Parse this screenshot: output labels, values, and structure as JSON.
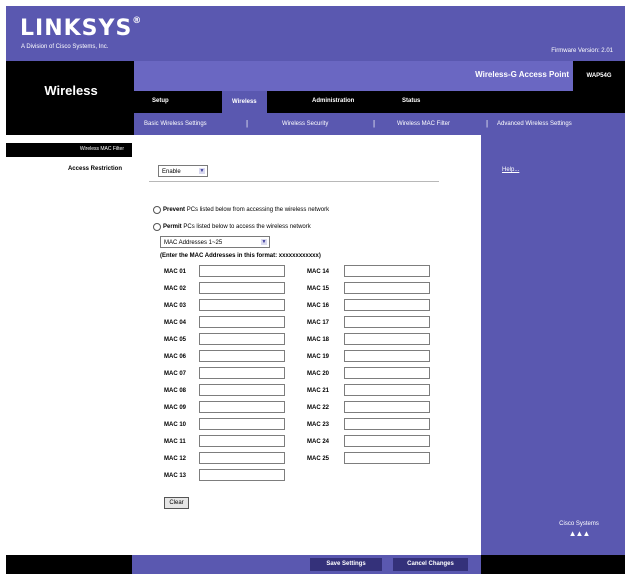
{
  "header": {
    "logo": "LINKSYS",
    "logo_mark": "®",
    "logo_sub": "A Division of Cisco Systems, Inc.",
    "firmware": "Firmware Version: 2.01"
  },
  "section": {
    "title": "Wireless"
  },
  "product": {
    "name": "Wireless-G Access Point",
    "model": "WAP54G"
  },
  "tabs": [
    {
      "label": "Setup"
    },
    {
      "label": "Wireless",
      "active": true
    },
    {
      "label": "Administration"
    },
    {
      "label": "Status"
    }
  ],
  "subtabs": [
    {
      "label": "Basic Wireless Settings"
    },
    {
      "label": "Wireless Security"
    },
    {
      "label": "Wireless MAC Filter",
      "active": true
    },
    {
      "label": "Advanced Wireless Settings"
    }
  ],
  "left": {
    "label1": "Wireless MAC Filter",
    "label2": "Access Restriction"
  },
  "restriction": {
    "value": "Enable",
    "prevent_strong": "Prevent",
    "prevent_text": "PCs listed below from accessing the wireless network",
    "permit_strong": "Permit",
    "permit_text": "PCs listed below to access the wireless network",
    "range_value": "MAC Addresses 1~25",
    "format_hint": "(Enter the MAC Addresses in this format: xxxxxxxxxxxx)"
  },
  "mac_left": [
    "MAC 01",
    "MAC 02",
    "MAC 03",
    "MAC 04",
    "MAC 05",
    "MAC 06",
    "MAC 07",
    "MAC 08",
    "MAC 09",
    "MAC 10",
    "MAC 11",
    "MAC 12",
    "MAC 13"
  ],
  "mac_right": [
    "MAC 14",
    "MAC 15",
    "MAC 16",
    "MAC 17",
    "MAC 18",
    "MAC 19",
    "MAC 20",
    "MAC 21",
    "MAC 22",
    "MAC 23",
    "MAC 24",
    "MAC 25"
  ],
  "buttons": {
    "clear": "Clear",
    "save": "Save Settings",
    "cancel": "Cancel Changes"
  },
  "help": {
    "link": "Help..."
  },
  "cisco": {
    "name": "Cisco Systems"
  },
  "colors": {
    "purple": "#5a58b0",
    "dark": "#000000",
    "button": "#34317a"
  }
}
